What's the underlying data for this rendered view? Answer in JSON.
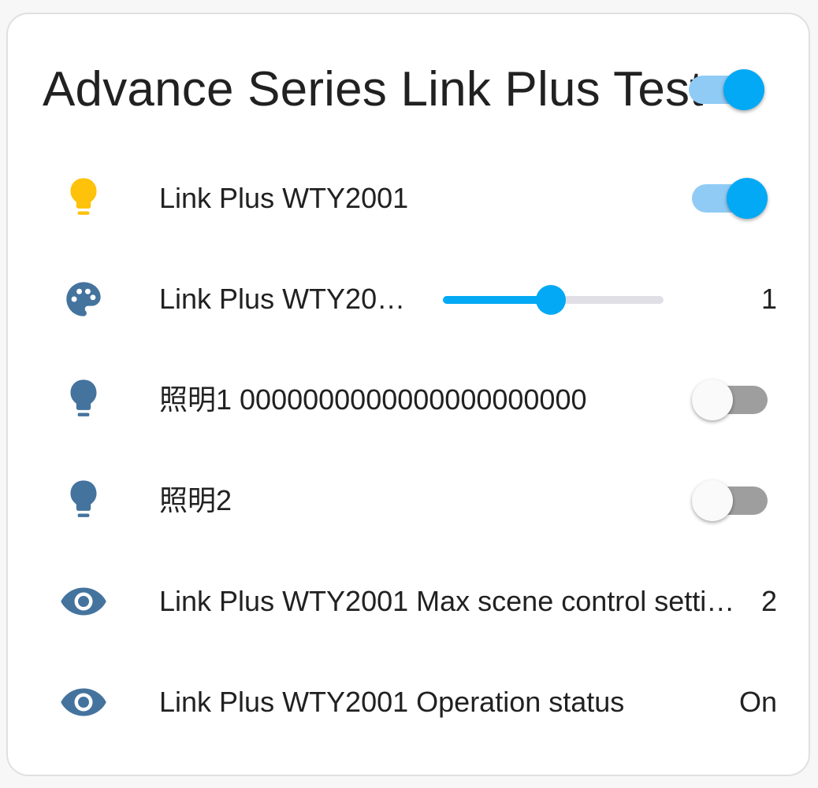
{
  "card": {
    "title": "Advance Series Link Plus Test",
    "master_toggle": "on"
  },
  "colors": {
    "accent": "#03a9f4",
    "bulb_on": "#fdc209",
    "icon_default": "#44739e"
  },
  "rows": [
    {
      "icon": "lightbulb-icon",
      "label": "Link Plus WTY2001",
      "control": "toggle",
      "state": "on"
    },
    {
      "icon": "palette-icon",
      "label": "Link Plus WTY20…",
      "control": "slider",
      "slider_fraction": 0.49,
      "value": "1"
    },
    {
      "icon": "lightbulb-icon",
      "label": "照明1  0000000000000000000000",
      "control": "toggle",
      "state": "off"
    },
    {
      "icon": "lightbulb-icon",
      "label": "照明2",
      "control": "toggle",
      "state": "off"
    },
    {
      "icon": "eye-icon",
      "label": "Link Plus WTY2001 Max scene control setti…",
      "control": "value",
      "value": "2"
    },
    {
      "icon": "eye-icon",
      "label": "Link Plus WTY2001 Operation status",
      "control": "value",
      "value": "On"
    }
  ]
}
